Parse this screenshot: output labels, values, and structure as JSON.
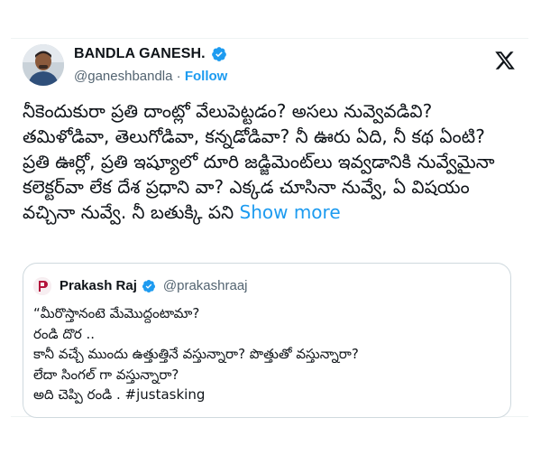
{
  "tweet": {
    "author_name": "BANDLA GANESH.",
    "author_handle": "@ganeshbandla",
    "separator": "·",
    "follow_label": "Follow",
    "text": "నీకెందుకురా ప్రతి దాంట్లో వేలుపెట్టడం? అసలు నువ్వెవడివి? తమిళోడివా, తెలుగోడివా, కన్నడోడివా? నీ ఊరు ఏది, నీ కథ ఏంటి? ప్రతి ఊర్లో, ప్రతి ఇష్యూలో దూరి జడ్జిమెంట్‌లు ఇవ్వడానికి నువ్వేమైనా కలెక్టర్‌వా లేక దేశ ప్రధాని వా? ఎక్కడ చూసినా నువ్వే, ఏ విషయం వచ్చినా నువ్వే. నీ బతుక్కి పని",
    "show_more_label": "Show more"
  },
  "quoted": {
    "author_name": "Prakash Raj",
    "author_handle": "@prakashraaj",
    "lines": [
      "“మీరొస్తానంటె మేమొద్దంటామా?",
      "రండి దొర ..",
      "కానీ వచ్చే ముందు ఉత్తుత్తినే వస్తున్నారా? పొత్తుతో వస్తున్నారా?",
      "లేదా సింగల్ గా వస్తున్నారా?",
      "అది చెప్పి రండి . #justasking"
    ]
  },
  "icons": {
    "verified": "verified-badge-icon",
    "platform": "x-logo-icon"
  },
  "colors": {
    "accent": "#1d9bf0",
    "text": "#0f1419",
    "secondary": "#536471",
    "border": "#cfd9de"
  }
}
